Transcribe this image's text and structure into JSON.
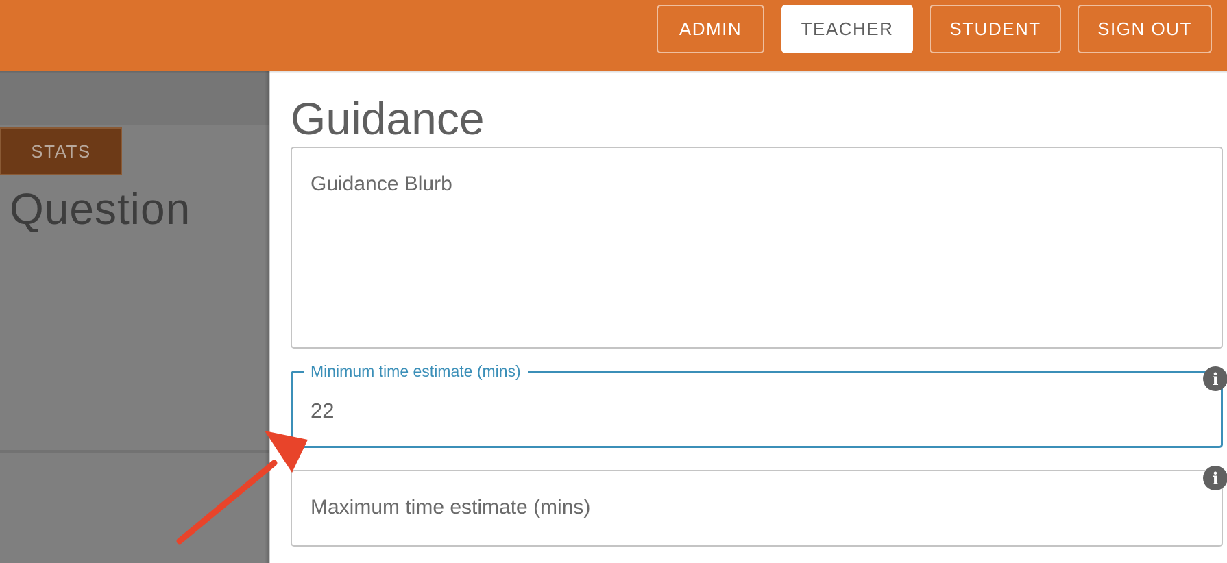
{
  "topbar": {
    "buttons": [
      {
        "label": "ADMIN",
        "active": false
      },
      {
        "label": "TEACHER",
        "active": true
      },
      {
        "label": "STUDENT",
        "active": false
      },
      {
        "label": "SIGN OUT",
        "active": false
      }
    ],
    "color": "#dc722c"
  },
  "left_panel": {
    "stats_tab": "STATS",
    "heading": "Question"
  },
  "main": {
    "title": "Guidance",
    "guidance_field": {
      "placeholder": "Guidance Blurb"
    },
    "min_time_field": {
      "label": "Minimum time estimate (mins)",
      "value": "22",
      "focused": true
    },
    "max_time_field": {
      "placeholder": "Maximum time estimate (mins)"
    },
    "info_icon_glyph": "i"
  },
  "colors": {
    "accent": "#3b8fb8",
    "annotation_arrow": "#e8442a"
  }
}
